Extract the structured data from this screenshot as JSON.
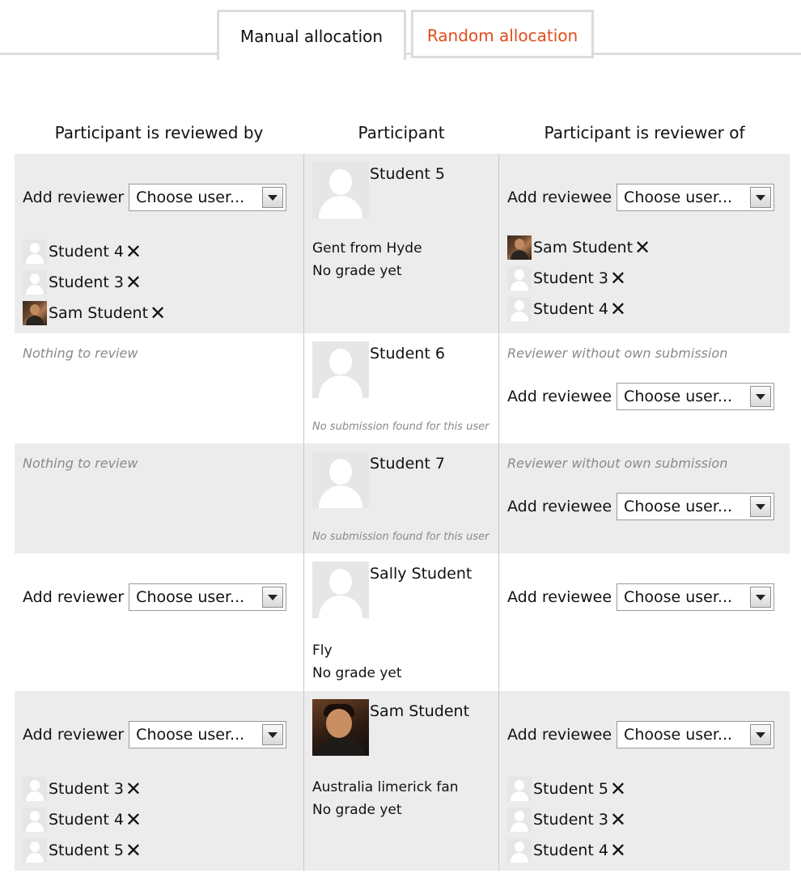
{
  "tabs": {
    "manual": "Manual allocation",
    "random": "Random allocation"
  },
  "headers": {
    "reviewed_by": "Participant is reviewed by",
    "participant": "Participant",
    "reviewer_of": "Participant is reviewer of"
  },
  "labels": {
    "add_reviewer": "Add reviewer",
    "add_reviewee": "Add reviewee",
    "choose_user": "Choose user...",
    "remove_mark": "✕",
    "nothing_to_review": "Nothing to review",
    "reviewer_without_submission": "Reviewer without own submission",
    "no_submission": "No submission found for this user",
    "no_grade": "No grade yet"
  },
  "rows": [
    {
      "participant": "Student 5",
      "submission": "Gent from Hyde",
      "reviewed_by": [
        "Student 4",
        "Student 3",
        "Sam Student"
      ],
      "reviewer_of": [
        "Sam Student",
        "Student 3",
        "Student 4"
      ]
    },
    {
      "participant": "Student 6"
    },
    {
      "participant": "Student 7"
    },
    {
      "participant": "Sally Student",
      "submission": "Fly"
    },
    {
      "participant": "Sam Student",
      "submission": "Australia limerick fan",
      "reviewed_by": [
        "Student 3",
        "Student 4",
        "Student 5"
      ],
      "reviewer_of": [
        "Student 5",
        "Student 3",
        "Student 4"
      ]
    }
  ]
}
